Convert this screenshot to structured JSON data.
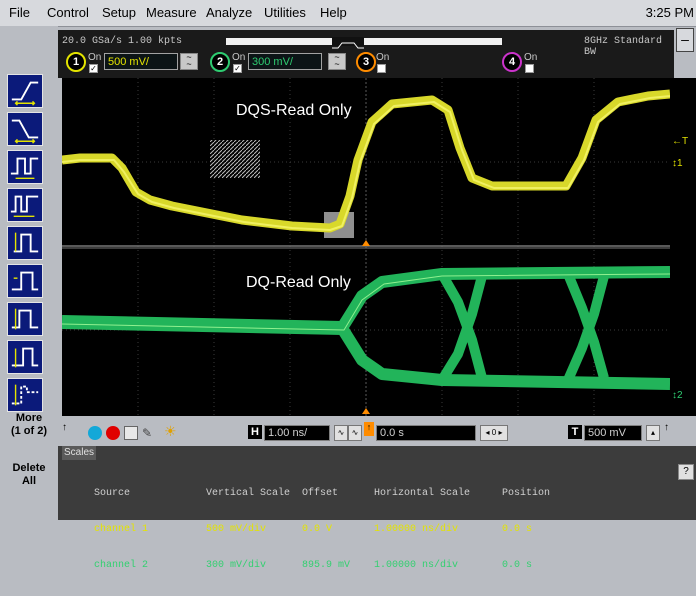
{
  "menu": {
    "items": [
      "File",
      "Control",
      "Setup",
      "Measure",
      "Analyze",
      "Utilities",
      "Help"
    ],
    "clock": "3:25 PM"
  },
  "sidebar": {
    "more_line1": "More",
    "more_line2": "(1 of 2)",
    "delete_line1": "Delete",
    "delete_line2": "All",
    "minimize": "–"
  },
  "acquisition": {
    "sample_rate": "20.0 GSa/s  1.00 kpts",
    "bandwidth": "8GHz Standard BW"
  },
  "channels": [
    {
      "number": "1",
      "state": "On",
      "scale": "500 mV/",
      "color": "#e4e400",
      "checked": true
    },
    {
      "number": "2",
      "state": "On",
      "scale": "300 mV/",
      "color": "#2ecc71",
      "checked": true
    },
    {
      "number": "3",
      "state": "On",
      "scale": "",
      "color": "#ff8c00",
      "checked": false
    },
    {
      "number": "4",
      "state": "On",
      "scale": "",
      "color": "#cc33cc",
      "checked": false
    }
  ],
  "waveforms": {
    "upper_label": "DQS-Read Only",
    "lower_label": "DQ-Read Only"
  },
  "markers": {
    "trig": "T",
    "ch1": "1",
    "ch2": "2"
  },
  "timebase": {
    "h_label": "H",
    "h_scale": "1.00 ns/",
    "delay": "0.0 s",
    "t_label": "T",
    "trigger_level": "500 mV"
  },
  "scales": {
    "tab": "Scales",
    "headers": {
      "source": "Source",
      "vertical": "Vertical Scale",
      "offset": "Offset",
      "horizontal": "Horizontal Scale",
      "position": "Position"
    },
    "rows": [
      {
        "source": "channel 1",
        "vertical": "500 mV/div",
        "offset": "0.0 V",
        "horizontal": "1.00000 ns/div",
        "position": "0.0 s"
      },
      {
        "source": "channel 2",
        "vertical": "300 mV/div",
        "offset": "895.9 mV",
        "horizontal": "1.00000 ns/div",
        "position": "0.0 s"
      }
    ],
    "help": "?"
  }
}
